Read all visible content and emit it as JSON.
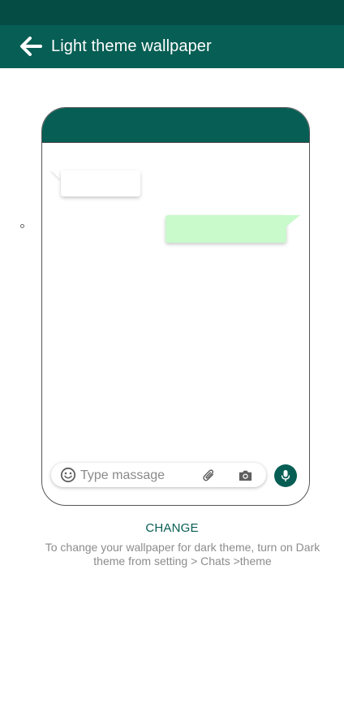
{
  "colors": {
    "status_bar": "#054d44",
    "app_bar": "#075e54",
    "accent": "#075e54",
    "outgoing_bubble": "#c8facb",
    "incoming_bubble": "#ffffff",
    "hint_text": "#8c8c8c"
  },
  "app_bar": {
    "back_icon": "arrow-left-icon",
    "title": "Light theme wallpaper"
  },
  "preview": {
    "input": {
      "placeholder": "Type massage",
      "emoji_icon": "smiley-icon",
      "attach_icon": "paperclip-icon",
      "camera_icon": "camera-icon"
    },
    "mic_icon": "microphone-icon"
  },
  "actions": {
    "change_label": "CHANGE"
  },
  "hint": {
    "text": "To change your wallpaper for dark theme, turn on Dark theme from setting > Chats >theme"
  }
}
